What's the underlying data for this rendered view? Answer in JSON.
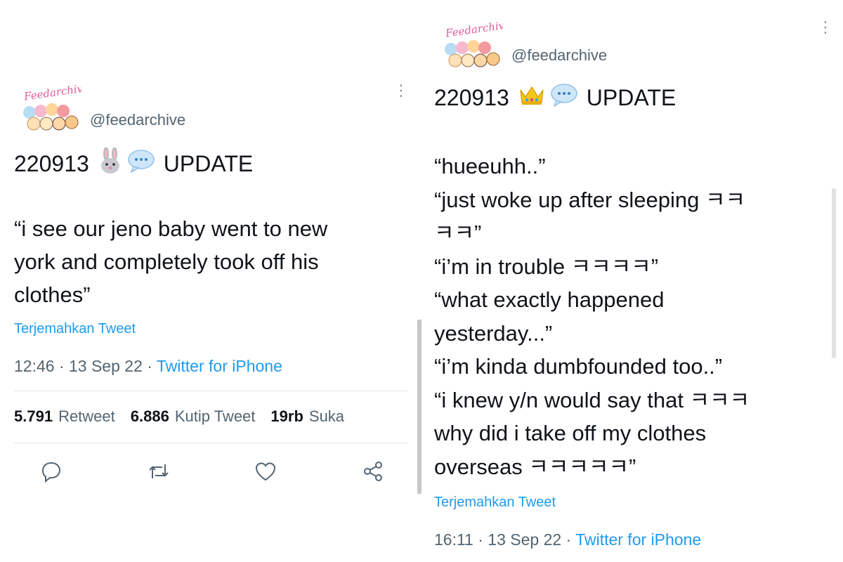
{
  "left_tweet": {
    "handle": "@feedarchive",
    "title_date": "220913",
    "title_word": "UPDATE",
    "title_emoji_1": "rabbit-face",
    "title_emoji_2": "speech-bubble",
    "body_lines": [
      "“i see our jeno baby went to new",
      "york and completely took off his",
      "clothes”"
    ],
    "translate_label": "Terjemahkan Tweet",
    "time": "12:46 · 13 Sep 22 · ",
    "source": "Twitter for iPhone",
    "stats": {
      "retweets_count": "5.791",
      "retweets_label": "Retweet",
      "quotes_count": "6.886",
      "quotes_label": "Kutip Tweet",
      "likes_count": "19rb",
      "likes_label": "Suka"
    },
    "actions": [
      "reply-icon",
      "retweet-icon",
      "like-icon",
      "share-icon"
    ]
  },
  "right_tweet": {
    "handle": "@feedarchive",
    "title_date": "220913",
    "title_word": "UPDATE",
    "title_emoji_1": "crown",
    "title_emoji_2": "speech-bubble",
    "body_lines": [
      "“hueeuhh..”",
      "“just woke up after sleeping ㅋㅋ",
      "ㅋㅋ”",
      "“i’m in trouble ㅋㅋㅋㅋ”",
      "“what exactly happened",
      "yesterday...”",
      "“i’m kinda dumbfounded too..”",
      "“i knew y/n would say that ㅋㅋㅋ",
      "why did i take off my clothes",
      "overseas ㅋㅋㅋㅋㅋ”"
    ],
    "translate_label": "Terjemahkan Tweet",
    "time": "16:11 · 13 Sep 22 · ",
    "source": "Twitter for iPhone"
  },
  "colors": {
    "link_blue": "#1d9bf0",
    "muted_gray": "#536471",
    "text": "#0f1419"
  }
}
